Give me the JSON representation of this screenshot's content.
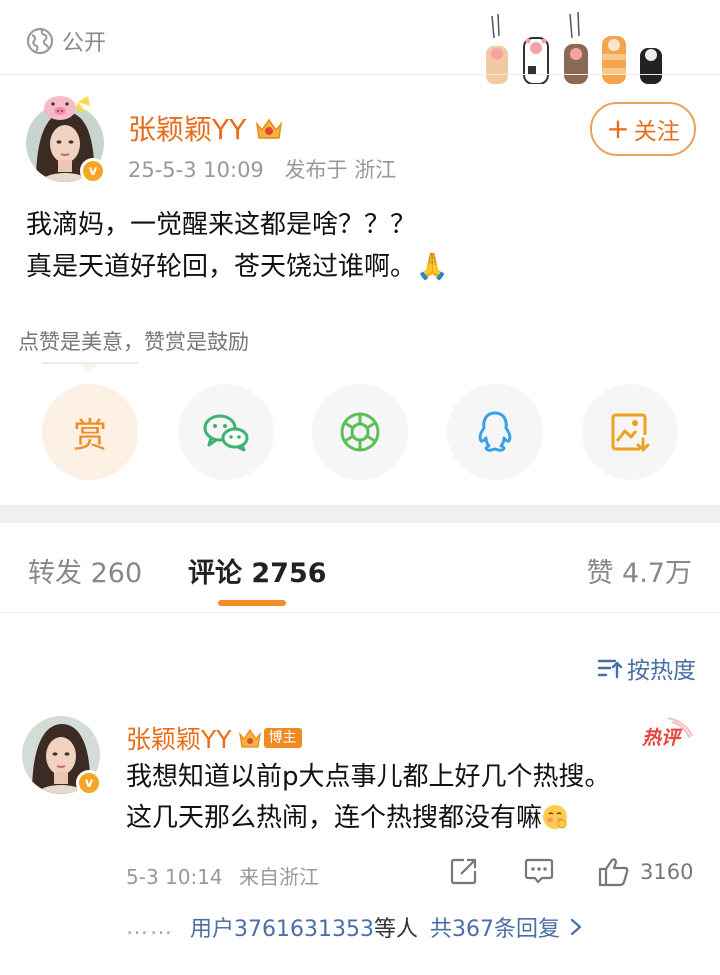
{
  "post": {
    "visibility": "公开",
    "author": {
      "name": "张颖颖YY",
      "verified_badge": "v",
      "avatar_icon": "avatar-woman"
    },
    "meta": {
      "time": "25-5-3 10:09",
      "location": "发布于 浙江"
    },
    "follow_label": "关注",
    "text_lines": [
      "我滴妈，一觉醒来这都是啥？？？",
      "真是天道好轮回，苍天饶过谁啊。🙏"
    ],
    "tip": "点赞是美意，赞赏是鼓励",
    "actions": [
      {
        "name": "reward",
        "label": "赏"
      },
      {
        "name": "wechat",
        "icon": "wechat-icon"
      },
      {
        "name": "moments",
        "icon": "moments-icon"
      },
      {
        "name": "qq",
        "icon": "qq-icon"
      },
      {
        "name": "save-image",
        "icon": "save-image-icon"
      }
    ]
  },
  "tabs": {
    "repost": "转发 260",
    "comments": "评论 2756",
    "likes": "赞 4.7万"
  },
  "sort_label": "按热度",
  "comment": {
    "author": "张颖颖YY",
    "badge": "博主",
    "hot_label": "热评",
    "text_lines": [
      "我想知道以前p大点事儿都上好几个热搜。",
      "这几天那么热闹，连个热搜都没有嘛"
    ],
    "time": "5-3 10:14",
    "location": "来自浙江",
    "like_count": "3160",
    "replies": {
      "dots": "……",
      "people": "用户3761631353",
      "suffix": "等人",
      "total": "共367条回复"
    }
  },
  "colors": {
    "accent": "#e86c1a",
    "link": "#4a6fa5",
    "indicator": "#f68c26"
  }
}
